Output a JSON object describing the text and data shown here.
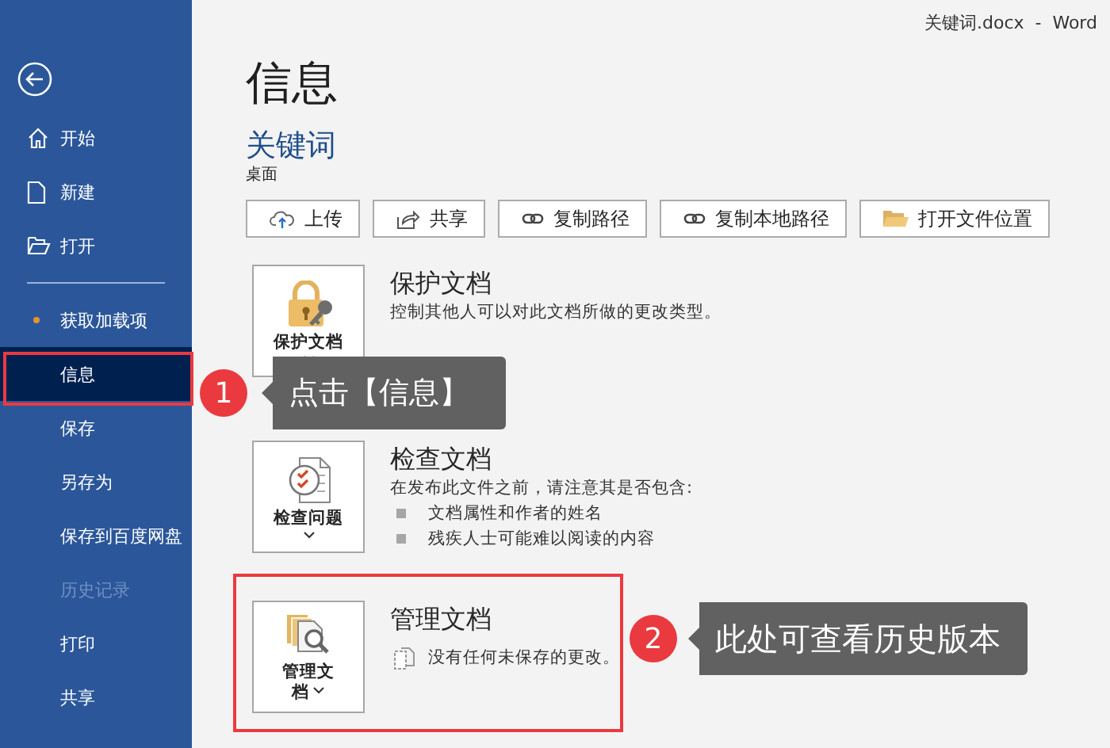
{
  "title_bar": {
    "text": "关键词.docx  -  Word"
  },
  "sidebar": {
    "primary": [
      {
        "label": "开始",
        "kind": "home",
        "selected": false,
        "disabled": false
      },
      {
        "label": "新建",
        "kind": "new",
        "selected": false,
        "disabled": false
      },
      {
        "label": "打开",
        "kind": "open",
        "selected": false,
        "disabled": false
      }
    ],
    "secondary": [
      {
        "label": "获取加载项",
        "kind": "addin",
        "selected": false,
        "disabled": false
      },
      {
        "label": "信息",
        "kind": "plain",
        "selected": true,
        "disabled": false
      },
      {
        "label": "保存",
        "kind": "plain",
        "selected": false,
        "disabled": false
      },
      {
        "label": "另存为",
        "kind": "plain",
        "selected": false,
        "disabled": false
      },
      {
        "label": "保存到百度网盘",
        "kind": "plain",
        "selected": false,
        "disabled": false
      },
      {
        "label": "历史记录",
        "kind": "plain",
        "selected": false,
        "disabled": true
      },
      {
        "label": "打印",
        "kind": "plain",
        "selected": false,
        "disabled": false
      },
      {
        "label": "共享",
        "kind": "plain",
        "selected": false,
        "disabled": false
      }
    ]
  },
  "page_title": "信息",
  "document": {
    "name": "关键词",
    "location": "桌面"
  },
  "actions": [
    {
      "label": "上传",
      "kind": "upload"
    },
    {
      "label": "共享",
      "kind": "share"
    },
    {
      "label": "复制路径",
      "kind": "link"
    },
    {
      "label": "复制本地路径",
      "kind": "link"
    },
    {
      "label": "打开文件位置",
      "kind": "folder"
    }
  ],
  "sections": [
    {
      "kind": "protect",
      "button_label": "保护文档",
      "title": "保护文档",
      "description": "控制其他人可以对此文档所做的更改类型。"
    },
    {
      "kind": "inspect",
      "button_label": "检查问题",
      "title": "检查文档",
      "description": "在发布此文件之前，请注意其是否包含:",
      "bullets": [
        "文档属性和作者的姓名",
        "残疾人士可能难以阅读的内容"
      ]
    },
    {
      "kind": "manage",
      "button_label": "管理文档",
      "title": "管理文档",
      "note": "没有任何未保存的更改。"
    }
  ],
  "annotations": [
    {
      "number": "1",
      "text": "点击【信息】"
    },
    {
      "number": "2",
      "text": "此处可查看历史版本"
    }
  ]
}
